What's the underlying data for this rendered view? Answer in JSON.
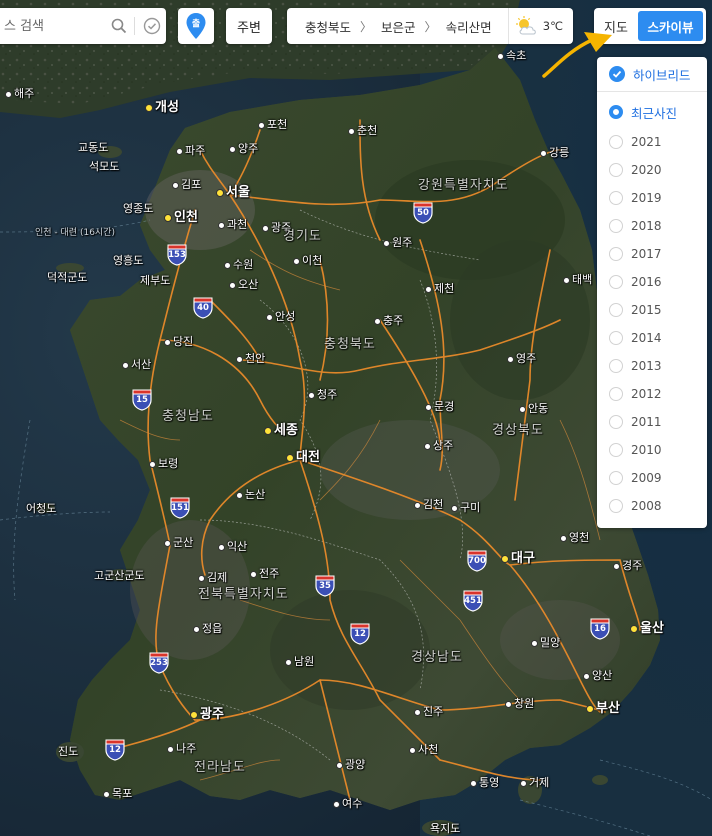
{
  "search": {
    "placeholder": "스 검색"
  },
  "toolbar": {
    "nearby_label": "주변",
    "pin_label": "출"
  },
  "breadcrumb": {
    "items": [
      "충청북도",
      "보은군",
      "속리산면"
    ]
  },
  "weather": {
    "temp": "3℃",
    "icon": "partly-cloudy-icon"
  },
  "map_type": {
    "map_label": "지도",
    "skyview_label": "스카이뷰",
    "selected": "스카이뷰"
  },
  "layer_panel": {
    "hybrid_label": "하이브리드",
    "hybrid_checked": true,
    "recent_label": "최근사진",
    "years": [
      "2021",
      "2020",
      "2019",
      "2018",
      "2017",
      "2016",
      "2015",
      "2014",
      "2013",
      "2012",
      "2011",
      "2010",
      "2009",
      "2008"
    ]
  },
  "colors": {
    "accent": "#2d8cf0",
    "arrow": "#f5b400",
    "road": "#e88a2a",
    "highway_shield": "#3b4fb5"
  },
  "map": {
    "place_labels": [
      "속초",
      "해주",
      "개성",
      "포천",
      "춘천",
      "교동도",
      "파주",
      "양주",
      "석모도",
      "강릉",
      "김포",
      "서울",
      "강원특별자치도",
      "영종도",
      "인천",
      "과천",
      "광주",
      "원주",
      "인천 - 대련 (16시간)",
      "경기도",
      "영흥도",
      "수원",
      "이천",
      "덕적군도",
      "제부도",
      "오산",
      "제천",
      "태백",
      "안성",
      "충주",
      "당진",
      "충청북도",
      "천안",
      "영주",
      "서산",
      "청주",
      "문경",
      "안동",
      "충청남도",
      "세종",
      "상주",
      "경상북도",
      "대전",
      "보령",
      "김천",
      "구미",
      "어청도",
      "논산",
      "영천",
      "군산",
      "익산",
      "대구",
      "경주",
      "고군산군도",
      "김제",
      "전주",
      "전북특별자치도",
      "정읍",
      "밀양",
      "울산",
      "남원",
      "경상남도",
      "양산",
      "광주",
      "진주",
      "창원",
      "부산",
      "진도",
      "나주",
      "사천",
      "전라남도",
      "광양",
      "통영",
      "거제",
      "목포",
      "여수",
      "욕지도"
    ],
    "highways": [
      "50",
      "153",
      "40",
      "15",
      "151",
      "700",
      "35",
      "451",
      "16",
      "12",
      "253",
      "12"
    ]
  }
}
